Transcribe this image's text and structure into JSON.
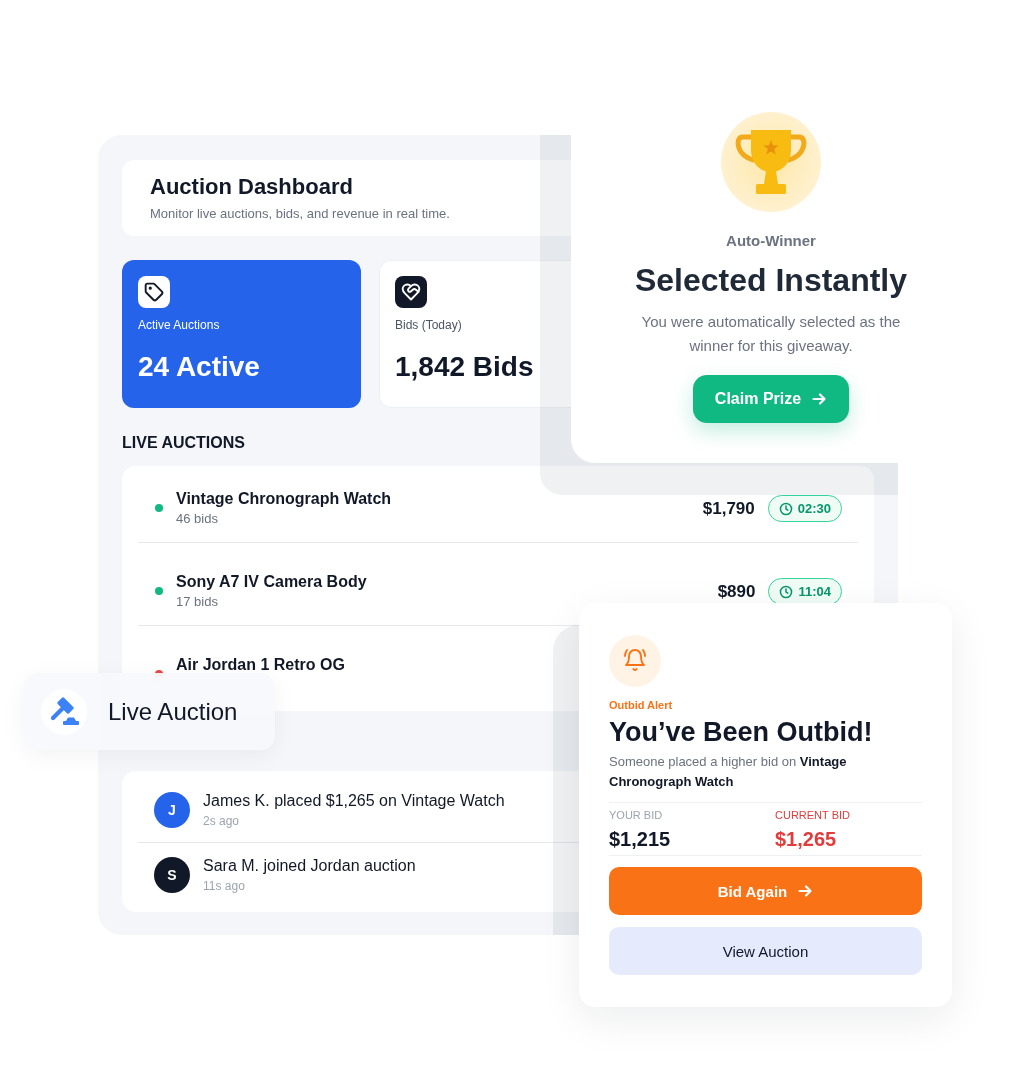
{
  "dashboard": {
    "title": "Auction Dashboard",
    "subtitle": "Monitor live auctions, bids, and revenue in real time.",
    "stats": [
      {
        "kind": "highlight",
        "label": "Active Auctions",
        "value": "24 Active"
      },
      {
        "kind": "plain",
        "label": "Bids (Today)",
        "value": "1,842 Bids"
      }
    ],
    "live_auctions": {
      "heading": "LIVE AUCTIONS",
      "items": [
        {
          "name": "Vintage Chronograph Watch",
          "bids": "46 bids",
          "color": "#10b981",
          "price": "$1,790",
          "time_left": "02:30"
        },
        {
          "name": "Sony A7 IV Camera Body",
          "bids": "17 bids",
          "color": "#10b981",
          "price": "$890",
          "time_left": "11:04"
        },
        {
          "name": "Air Jordan 1 Retro OG",
          "color": "#ef4444"
        }
      ]
    },
    "activity": [
      {
        "initial": "J",
        "color": "#2563eb",
        "text": "James K. placed $1,265 on Vintage Watch",
        "time": "2s ago"
      },
      {
        "initial": "S",
        "color": "#111827",
        "text": "Sara M. joined Jordan auction",
        "time": "11s ago"
      }
    ]
  },
  "winner_card": {
    "eyebrow": "Auto-Winner",
    "title": "Selected Instantly",
    "message": "You were automatically selected as the winner for this giveaway.",
    "button": "Claim Prize"
  },
  "live_badge": {
    "label": "Live Auction"
  },
  "outbid_card": {
    "eyebrow": "Outbid Alert",
    "title": "You’ve Been Outbid!",
    "message": "Someone placed a higher bid on **Vintage Chronograph Watch**",
    "bids": [
      {
        "kind": "yours",
        "label": "YOUR BID",
        "amount": "$1,215"
      },
      {
        "kind": "current",
        "label": "CURRENT BID",
        "amount": "$1,265"
      }
    ],
    "buttons": [
      {
        "kind": "primary",
        "label": "Bid Again"
      },
      {
        "kind": "secondary",
        "label": "View Auction"
      }
    ]
  }
}
